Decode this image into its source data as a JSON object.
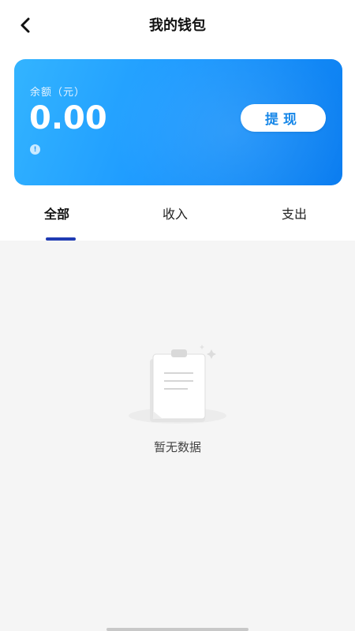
{
  "header": {
    "title": "我的钱包",
    "back_icon": "chevron-left-icon"
  },
  "card": {
    "balance_label": "余额（元）",
    "balance_amount": "0.00",
    "info_icon": "!",
    "withdraw_label": "提现",
    "gradient": [
      "#33b4ff",
      "#0b7df0"
    ]
  },
  "tabs": [
    {
      "label": "全部",
      "active": true
    },
    {
      "label": "收入",
      "active": false
    },
    {
      "label": "支出",
      "active": false
    }
  ],
  "empty_state": {
    "text": "暂无数据",
    "icon": "clipboard-icon"
  },
  "colors": {
    "accent": "#1f3bb3",
    "content_bg": "#f5f5f5"
  }
}
